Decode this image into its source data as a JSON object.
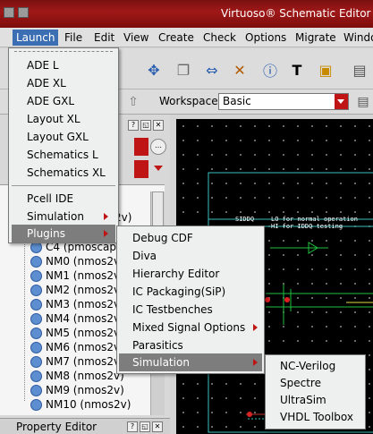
{
  "window": {
    "title": "Virtuoso® Schematic Editor L E"
  },
  "menubar": {
    "items": [
      "Launch",
      "File",
      "Edit",
      "View",
      "Create",
      "Check",
      "Options",
      "Migrate",
      "Windo"
    ]
  },
  "toolbar": {
    "workspace_label": "Workspace:",
    "workspace_value": "Basic"
  },
  "launch_menu": {
    "items": [
      "ADE L",
      "ADE XL",
      "ADE GXL",
      "Layout XL",
      "Layout GXL",
      "Schematics L",
      "Schematics XL",
      "Pcell IDE",
      "Simulation",
      "Plugins"
    ],
    "highlighted": "Plugins"
  },
  "plugins_menu": {
    "items": [
      "Debug CDF",
      "Diva",
      "Hierarchy Editor",
      "IC Packaging(SiP)",
      "IC Testbenches",
      "Mixed Signal Options",
      "Parasitics",
      "Simulation"
    ],
    "highlighted": "Simulation"
  },
  "simulation_menu": {
    "items": [
      "NC-Verilog",
      "Spectre",
      "UltraSim",
      "VHDL Toolbox"
    ]
  },
  "navigator": {
    "partial_text": "2v)",
    "instances": [
      "C4 (pmoscap)",
      "NM0 (nmos2v)",
      "NM1 (nmos2v)",
      "NM2 (nmos2v)",
      "NM3 (nmos2v)",
      "NM4 (nmos2v)",
      "NM5 (nmos2v)",
      "NM6 (nmos2v)",
      "NM7 (nmos2v)",
      "NM8 (nmos2v)",
      "NM9 (nmos2v)",
      "NM10 (nmos2v)"
    ]
  },
  "property_editor": {
    "title": "Property Editor"
  },
  "schematic": {
    "net_label": "SIDDQ",
    "note_line1": "LO for normal operation",
    "note_line2": "HI for IDDQ testing"
  }
}
